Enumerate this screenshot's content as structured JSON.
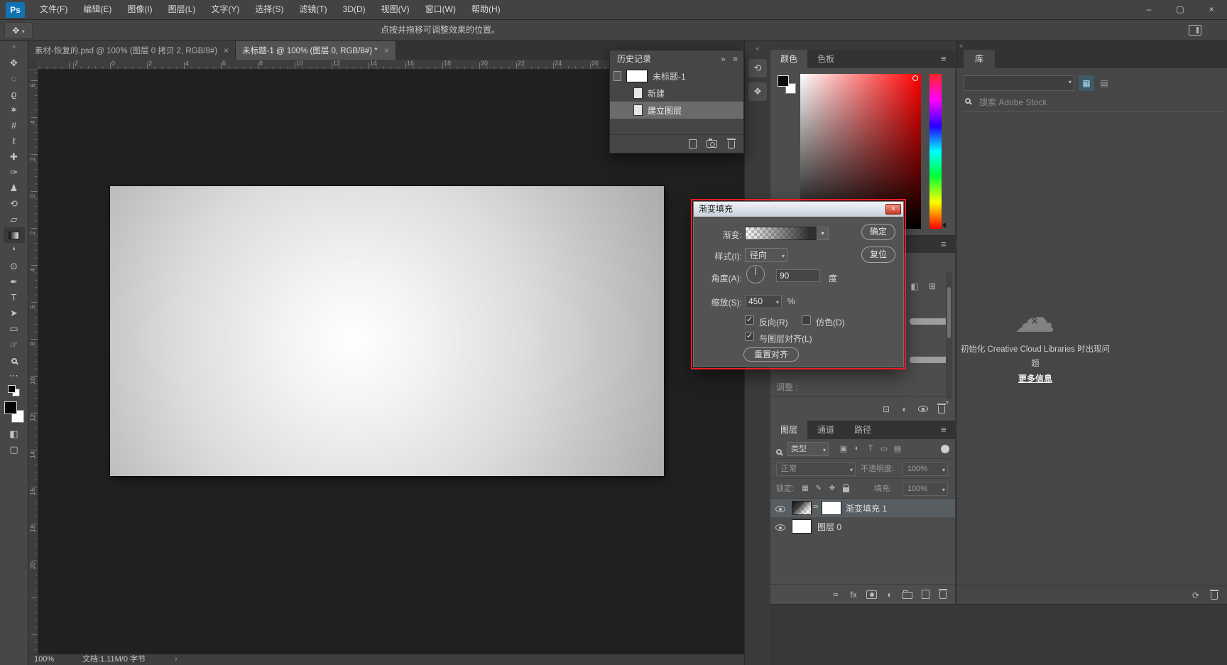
{
  "icons": {
    "hamburger": "≡",
    "chevrons_right": "»",
    "chevrons_left": "«",
    "chevron_down": "▾",
    "triangle_right": "›",
    "close": "×",
    "minimize": "–",
    "maximize": "▢",
    "move_tool": "✥",
    "sync": "⟳",
    "cloud": "☁",
    "cloud_error_x": "×"
  },
  "colors": {
    "annotation_red": "#ec1c24",
    "selected_layer_gray": "#585d61",
    "dialog_title_bar": "#c7d1dc"
  },
  "window": {
    "logo": "Ps"
  },
  "menubar": {
    "items": [
      {
        "label": "文件(F)"
      },
      {
        "label": "编辑(E)"
      },
      {
        "label": "图像(I)"
      },
      {
        "label": "图层(L)"
      },
      {
        "label": "文字(Y)"
      },
      {
        "label": "选择(S)"
      },
      {
        "label": "滤镜(T)"
      },
      {
        "label": "3D(D)"
      },
      {
        "label": "视图(V)"
      },
      {
        "label": "窗口(W)"
      },
      {
        "label": "帮助(H)"
      }
    ]
  },
  "options_bar": {
    "hint": "点按并拖移可调整效果的位置。"
  },
  "document_tabs": [
    {
      "title": "素材-恢复的.psd @ 100% (图层 0 拷贝 2, RGB/8#)",
      "close": "×",
      "active": false
    },
    {
      "title": "未标题-1 @ 100% (图层 0, RGB/8#) *",
      "close": "×",
      "active": true
    }
  ],
  "toolbar": {
    "tools": [
      {
        "name": "move-tool",
        "glyph": "✥"
      },
      {
        "name": "marquee-tool",
        "glyph": "◌"
      },
      {
        "name": "lasso-tool",
        "glyph": "ϱ"
      },
      {
        "name": "quick-selection-tool",
        "glyph": "✶"
      },
      {
        "name": "crop-tool",
        "glyph": "#"
      },
      {
        "name": "eyedropper-tool",
        "glyph": "ℓ"
      },
      {
        "name": "healing-brush-tool",
        "glyph": "✚"
      },
      {
        "name": "brush-tool",
        "glyph": "✑"
      },
      {
        "name": "clone-stamp-tool",
        "glyph": "♟"
      },
      {
        "name": "history-brush-tool",
        "glyph": "⟲"
      },
      {
        "name": "eraser-tool",
        "glyph": "▱"
      },
      {
        "name": "gradient-tool",
        "cls": "gradient",
        "selected": true
      },
      {
        "name": "blur-tool",
        "glyph": "❛"
      },
      {
        "name": "dodge-tool",
        "glyph": "⊙"
      },
      {
        "name": "pen-tool",
        "glyph": "✒"
      },
      {
        "name": "type-tool",
        "glyph": "T"
      },
      {
        "name": "path-selection-tool",
        "glyph": "➤"
      },
      {
        "name": "rectangle-tool",
        "glyph": "▭"
      },
      {
        "name": "hand-tool",
        "glyph": "☞"
      },
      {
        "name": "zoom-tool",
        "cls": "lens"
      },
      {
        "name": "tool-ellipsis",
        "glyph": "⋯"
      },
      {
        "name": "default-colors-mini",
        "cls": "minicolors"
      },
      {
        "name": "foreground-background-colors",
        "cls": "bigcolors"
      },
      {
        "name": "quick-mask-button",
        "glyph": "◧"
      },
      {
        "name": "screen-mode-button",
        "glyph": "▢"
      }
    ]
  },
  "rulers": {
    "top_numbers": [
      "2",
      "0",
      "2",
      "4",
      "6",
      "8",
      "10",
      "12",
      "14",
      "16",
      "18",
      "20",
      "22",
      "24",
      "26"
    ],
    "left_numbers": [
      "6",
      "4",
      "2",
      "0",
      "2",
      "4",
      "6",
      "8",
      "10",
      "12",
      "14",
      "16",
      "18",
      "20"
    ]
  },
  "history_panel": {
    "title": "历史记录",
    "items": [
      {
        "label": "未标题-1",
        "kind": "thumb",
        "cls": "srcon"
      },
      {
        "label": "新建",
        "kind": "doc"
      },
      {
        "label": "建立图层",
        "kind": "doc",
        "selected": true
      }
    ],
    "footer_icons": [
      {
        "name": "new-document-from-state-icon",
        "cls": "newdoc"
      },
      {
        "name": "new-snapshot-icon",
        "cls": "camera"
      },
      {
        "name": "delete-state-icon",
        "cls": "trash"
      }
    ]
  },
  "collapsed_dock": {
    "buttons": [
      {
        "name": "history-panel-icon",
        "glyph": "⟲"
      },
      {
        "name": "properties-panel-icon",
        "glyph": "❖"
      }
    ]
  },
  "color_panel": {
    "tabs": [
      {
        "label": "颜色",
        "active": true
      },
      {
        "label": "色板",
        "active": false
      }
    ]
  },
  "properties_panel": {
    "adjust_label": "调整 :",
    "side_icons": [
      {
        "name": "mask-properties-icon",
        "glyph": "◧"
      },
      {
        "name": "add-adjustment-icon",
        "glyph": "⊞"
      }
    ],
    "footer_icons": [
      {
        "name": "clip-to-layer-icon",
        "glyph": "⊡"
      },
      {
        "name": "toggle-mask-icon",
        "glyph": "◐"
      },
      {
        "name": "visibility-icon",
        "cls": "eyeic"
      },
      {
        "name": "delete-adjustment-icon",
        "cls": "trash"
      }
    ]
  },
  "dialog": {
    "title": "渐变填充",
    "gradient_label": "渐变:",
    "style_label": "样式(I):",
    "style_value": "径向",
    "angle_label": "角度(A):",
    "angle_value": "90",
    "angle_unit": "度",
    "scale_label": "缩放(S):",
    "scale_value": "450",
    "scale_unit": "%",
    "reverse_label": "反向(R)",
    "reverse_checked": true,
    "dither_label": "仿色(D)",
    "dither_checked": false,
    "align_label": "与图层对齐(L)",
    "align_checked": true,
    "reset_align_button": "重置对齐",
    "ok_button": "确定",
    "reset_button": "复位"
  },
  "layers_panel": {
    "tabs": [
      {
        "label": "图层",
        "active": true
      },
      {
        "label": "通道",
        "active": false
      },
      {
        "label": "路径",
        "active": false
      }
    ],
    "type_filter_label": "类型",
    "filter_icons": [
      {
        "name": "filter-pixel-layers-icon",
        "glyph": "▣"
      },
      {
        "name": "filter-adjustment-layers-icon",
        "glyph": "◐"
      },
      {
        "name": "filter-type-layers-icon",
        "glyph": "T"
      },
      {
        "name": "filter-shape-layers-icon",
        "glyph": "▭"
      },
      {
        "name": "filter-smart-objects-icon",
        "glyph": "▤"
      }
    ],
    "blend_mode": "正常",
    "opacity_label": "不透明度:",
    "opacity_value": "100%",
    "lock_label": "锁定:",
    "lock_icons": [
      {
        "name": "lock-transparency-icon",
        "glyph": "▦"
      },
      {
        "name": "lock-pixels-icon",
        "glyph": "✎"
      },
      {
        "name": "lock-position-icon",
        "glyph": "✥"
      },
      {
        "name": "lock-all-icon",
        "cls": "lockpad"
      }
    ],
    "fill_label": "填充:",
    "fill_value": "100%",
    "rows": [
      {
        "label": "渐变填充 1",
        "kind": "gradient",
        "selected": true
      },
      {
        "label": "图层 0",
        "kind": "white",
        "selected": false
      }
    ],
    "footer_icons": [
      {
        "name": "link-layers-icon",
        "glyph": "8",
        "cls": "chain"
      },
      {
        "name": "layer-styles-icon",
        "glyph": "fx"
      },
      {
        "name": "add-layer-mask-icon",
        "cls": "maskic"
      },
      {
        "name": "new-adjustment-layer-icon",
        "glyph": "◐"
      },
      {
        "name": "new-group-icon",
        "cls": "folder"
      },
      {
        "name": "new-layer-icon",
        "cls": "newdoc"
      },
      {
        "name": "delete-layer-icon",
        "cls": "trash"
      }
    ]
  },
  "libraries_panel": {
    "tab": "库",
    "search_placeholder": "搜索 Adobe Stock",
    "error_message": "初始化 Creative Cloud Libraries 时出现问题",
    "more_info_link": "更多信息",
    "footer_icons": [
      {
        "name": "sync-libraries-icon",
        "glyph": "⟳"
      },
      {
        "name": "delete-library-item-icon",
        "cls": "trash"
      }
    ]
  },
  "status_bar": {
    "zoom": "100%",
    "doc_info": "文档:1.11M/0 字节",
    "expander": "›"
  }
}
